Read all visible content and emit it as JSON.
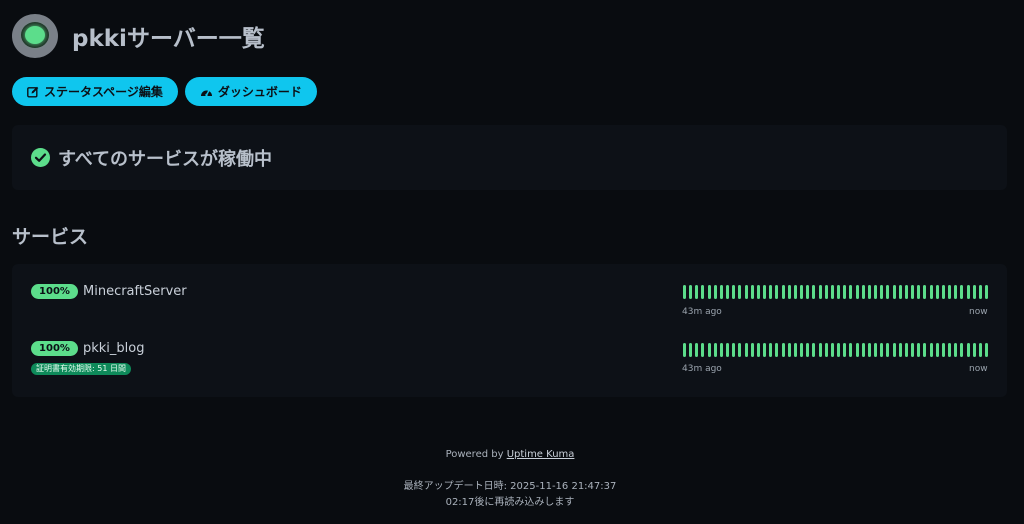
{
  "header": {
    "title": "pkkiサーバー一覧"
  },
  "actions": {
    "edit_label": "ステータスページ編集",
    "dashboard_label": "ダッシュボード"
  },
  "overall_status": {
    "text": "すべてのサービスが稼働中"
  },
  "services_section": {
    "title": "サービス"
  },
  "services": [
    {
      "uptime": "100%",
      "name": "MinecraftServer",
      "cert": "",
      "beats": 50,
      "start_label": "43m ago",
      "end_label": "now"
    },
    {
      "uptime": "100%",
      "name": "pkki_blog",
      "cert": "証明書有効期限: 51 日間",
      "beats": 50,
      "start_label": "43m ago",
      "end_label": "now"
    }
  ],
  "footer": {
    "powered_prefix": "Powered by ",
    "powered_link": "Uptime Kuma",
    "last_updated": "最終アップデート日時: 2025-11-16 21:47:37",
    "refresh": "02:17後に再読み込みします"
  },
  "colors": {
    "accent": "#0fc6ee",
    "up": "#5cdd8b",
    "cert": "#0e8a5a",
    "background": "#090c10"
  }
}
